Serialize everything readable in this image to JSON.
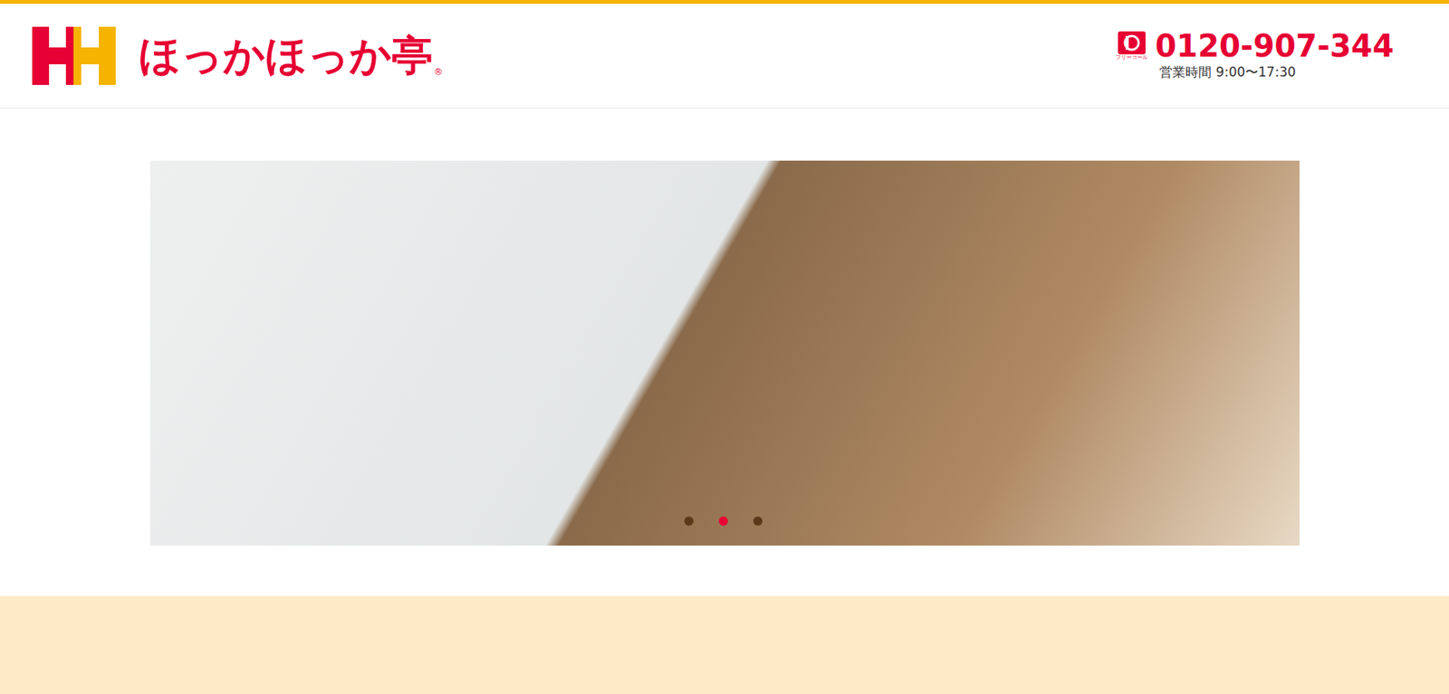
{
  "header": {
    "logo": {
      "text": "ほっかほっか亭",
      "mark": "®"
    },
    "phone": {
      "icon_label": "フリーコール",
      "number": "0120-907-344",
      "hours": "営業時間 9:00〜17:30"
    }
  },
  "carousel": {
    "dots": [
      {
        "selected": false
      },
      {
        "selected": true
      },
      {
        "selected": false
      }
    ]
  }
}
